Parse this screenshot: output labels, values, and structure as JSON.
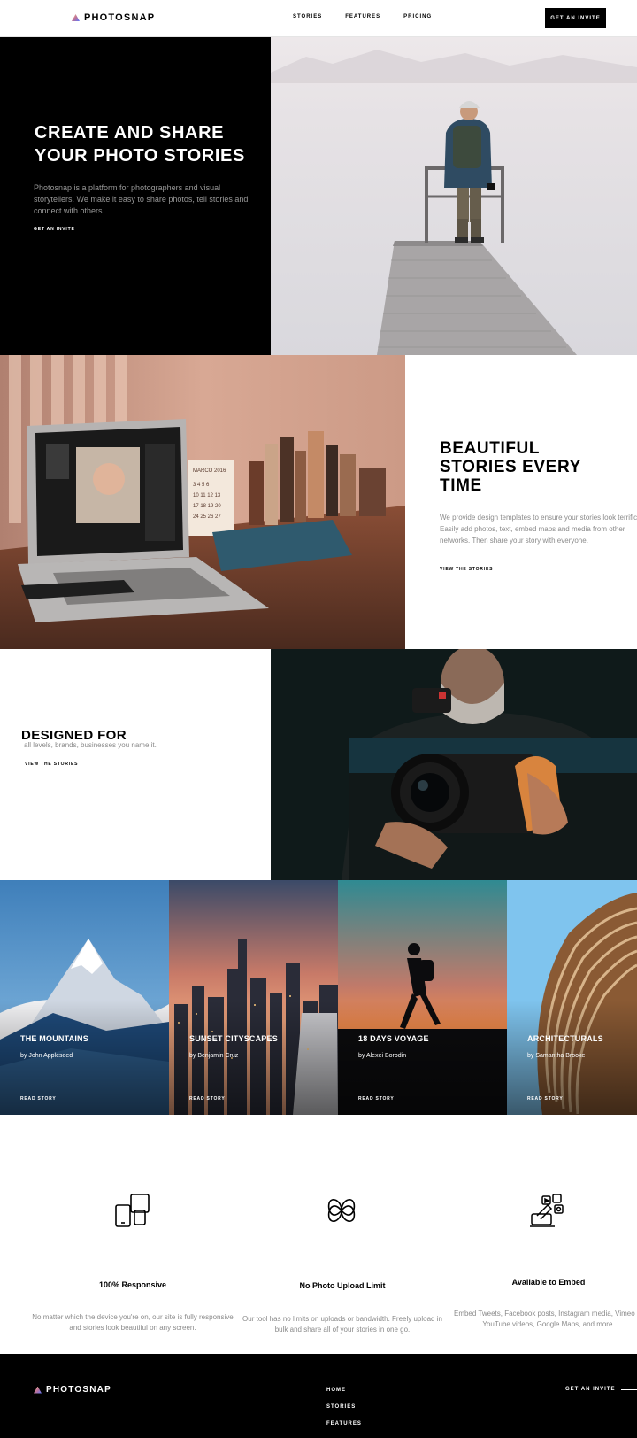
{
  "header": {
    "logo": "PHOTOSNAP",
    "nav": [
      "STORIES",
      "FEATURES",
      "PRICING"
    ],
    "cta": "GET AN INVITE"
  },
  "hero": {
    "title": "CREATE AND SHARE YOUR PHOTO STORIES",
    "text": "Photosnap is a platform for photographers and visual storytellers. We make it easy to share photos, tell stories and connect with others",
    "link": "GET AN INVITE"
  },
  "section2": {
    "title": "BEAUTIFUL STORIES EVERY TIME",
    "text": "We provide design templates to ensure your stories look terrific. Easily add photos, text, embed maps and media from other networks. Then share your story with everyone.",
    "link": "VIEW THE STORIES"
  },
  "section3": {
    "title": "DESIGNED FOR",
    "subtitle": "all levels, brands, businesses you name it.",
    "link": "VIEW THE STORIES"
  },
  "stories": [
    {
      "title": "THE MOUNTAINS",
      "author": "by John Appleseed",
      "link": "READ STORY"
    },
    {
      "title": "SUNSET CITYSCAPES",
      "author": "by Benjamin Cruz",
      "link": "READ STORY"
    },
    {
      "title": "18 DAYS VOYAGE",
      "author": "by Alexei Borodin",
      "link": "READ STORY"
    },
    {
      "title": "ARCHITECTURALS",
      "author": "by Samantha Brooke",
      "link": "READ STORY"
    }
  ],
  "features": [
    {
      "icon": "responsive-devices-icon",
      "title": "100% Responsive",
      "text": "No matter which the device you're on, our site is fully responsive and stories look beautiful on any screen."
    },
    {
      "icon": "infinity-icon",
      "title": "No Photo Upload Limit",
      "text": "Our tool has no limits on uploads or bandwidth. Freely upload in bulk and share all of your stories in one go."
    },
    {
      "icon": "embed-icon",
      "title": "Available to Embed",
      "text": "Embed Tweets, Facebook posts, Instagram media, Vimeo or YouTube videos, Google Maps, and more."
    }
  ],
  "footer": {
    "logo": "PHOTOSNAP",
    "nav": [
      "HOME",
      "STORIES",
      "FEATURES"
    ],
    "cta": "GET AN INVITE"
  },
  "colors": {
    "logo_gradient": [
      "#ffc593",
      "#bc7198",
      "#5a77ff"
    ],
    "dark": "#000000",
    "muted_text": "#8a8a8a"
  },
  "photo_subjects": {
    "hero": "hiker-on-pier-photo",
    "section2": "laptop-desk-photo",
    "section3": "videographer-camera-photo"
  }
}
